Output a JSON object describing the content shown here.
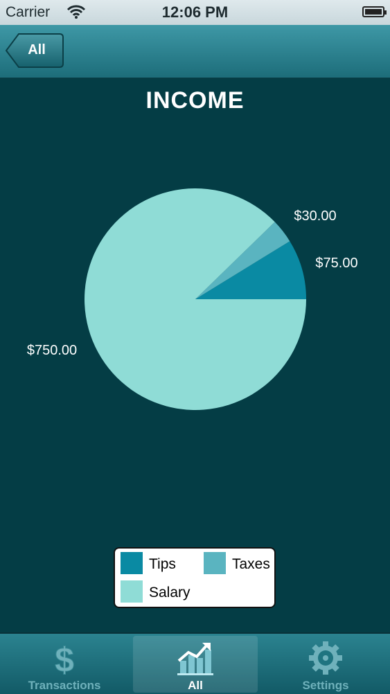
{
  "status_bar": {
    "carrier": "Carrier",
    "time": "12:06 PM",
    "battery_level": 1.0
  },
  "nav": {
    "back_label": "All"
  },
  "page": {
    "title": "INCOME"
  },
  "colors": {
    "tips": "#0a8aa3",
    "taxes": "#5ab4c0",
    "salary": "#8fdcd6",
    "background": "#043d45"
  },
  "chart_data": {
    "type": "pie",
    "title": "INCOME",
    "slices": [
      {
        "name": "Tips",
        "value": 75,
        "label": "$75.00",
        "color": "#0a8aa3"
      },
      {
        "name": "Taxes",
        "value": 30,
        "label": "$30.00",
        "color": "#5ab4c0"
      },
      {
        "name": "Salary",
        "value": 750,
        "label": "$750.00",
        "color": "#8fdcd6"
      }
    ],
    "legend": [
      "Tips",
      "Taxes",
      "Salary"
    ],
    "legend_position": "bottom"
  },
  "tabs": [
    {
      "label": "Transactions",
      "icon": "dollar-icon",
      "active": false
    },
    {
      "label": "All",
      "icon": "chart-icon",
      "active": true
    },
    {
      "label": "Settings",
      "icon": "gear-icon",
      "active": false
    }
  ]
}
